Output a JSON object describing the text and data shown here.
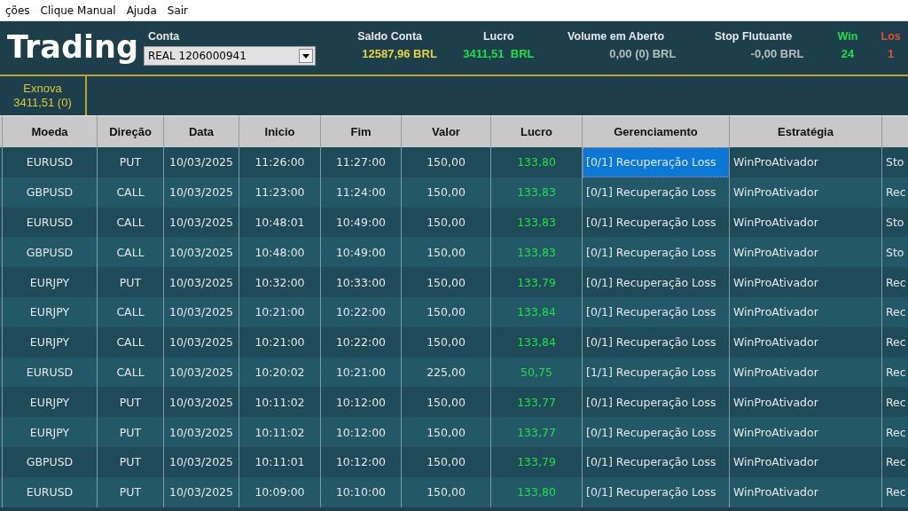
{
  "menu": [
    "ções",
    "Clique Manual",
    "Ajuda",
    "Sair"
  ],
  "header": {
    "title": "Trading",
    "account": {
      "label": "Conta",
      "value": "REAL 1206000941"
    },
    "stats": [
      {
        "label": "Saldo Conta",
        "value": "12587,96 BRL",
        "color": "#e8d53c",
        "kind": "amount"
      },
      {
        "label": "Lucro",
        "value": "3411,51  BRL",
        "color": "#1fe048",
        "kind": "amount"
      },
      {
        "label": "Volume em Aberto",
        "value": "0,00 (0) BRL",
        "color": "#b8bcbe",
        "kind": "amount"
      },
      {
        "label": "Stop Flutuante",
        "value": "-0,00 BRL",
        "color": "#b8bcbe",
        "kind": "amount"
      },
      {
        "label": "Win",
        "value": "24",
        "color": "#1fe048",
        "kind": "count"
      },
      {
        "label": "Los",
        "value": "1",
        "color": "#e0522e",
        "kind": "count"
      }
    ]
  },
  "tabs": [
    {
      "label": "Exnova",
      "value": "3411,51 (0)",
      "selected": true
    }
  ],
  "table": {
    "columns": [
      "Moeda",
      "Direção",
      "Data",
      "Inicio",
      "Fim",
      "Valor",
      "Lucro",
      "Gerenciamento",
      "Estratégia"
    ],
    "rows": [
      {
        "selected": true,
        "cells": [
          "EURUSD",
          "PUT",
          "10/03/2025",
          "11:26:00",
          "11:27:00",
          "150,00",
          "133,80",
          "[0/1] Recuperação Loss",
          "WinProAtivador",
          "Sto"
        ]
      },
      {
        "selected": false,
        "cells": [
          "GBPUSD",
          "CALL",
          "10/03/2025",
          "11:23:00",
          "11:24:00",
          "150,00",
          "133,83",
          "[0/1] Recuperação Loss",
          "WinProAtivador",
          "Rec"
        ]
      },
      {
        "selected": false,
        "cells": [
          "EURUSD",
          "CALL",
          "10/03/2025",
          "10:48:01",
          "10:49:00",
          "150,00",
          "133,83",
          "[0/1] Recuperação Loss",
          "WinProAtivador",
          "Sto"
        ]
      },
      {
        "selected": false,
        "cells": [
          "GBPUSD",
          "CALL",
          "10/03/2025",
          "10:48:00",
          "10:49:00",
          "150,00",
          "133,83",
          "[0/1] Recuperação Loss",
          "WinProAtivador",
          "Sto"
        ]
      },
      {
        "selected": false,
        "cells": [
          "EURJPY",
          "PUT",
          "10/03/2025",
          "10:32:00",
          "10:33:00",
          "150,00",
          "133,79",
          "[0/1] Recuperação Loss",
          "WinProAtivador",
          "Rec"
        ]
      },
      {
        "selected": false,
        "cells": [
          "EURJPY",
          "CALL",
          "10/03/2025",
          "10:21:00",
          "10:22:00",
          "150,00",
          "133,84",
          "[0/1] Recuperação Loss",
          "WinProAtivador",
          "Rec"
        ]
      },
      {
        "selected": false,
        "cells": [
          "EURJPY",
          "CALL",
          "10/03/2025",
          "10:21:00",
          "10:22:00",
          "150,00",
          "133,84",
          "[0/1] Recuperação Loss",
          "WinProAtivador",
          "Rec"
        ]
      },
      {
        "selected": false,
        "cells": [
          "EURUSD",
          "CALL",
          "10/03/2025",
          "10:20:02",
          "10:21:00",
          "225,00",
          "50,75",
          "[1/1] Recuperação Loss",
          "WinProAtivador",
          "Rec"
        ]
      },
      {
        "selected": false,
        "cells": [
          "EURJPY",
          "PUT",
          "10/03/2025",
          "10:11:02",
          "10:12:00",
          "150,00",
          "133,77",
          "[0/1] Recuperação Loss",
          "WinProAtivador",
          "Rec"
        ]
      },
      {
        "selected": false,
        "cells": [
          "EURJPY",
          "PUT",
          "10/03/2025",
          "10:11:02",
          "10:12:00",
          "150,00",
          "133,77",
          "[0/1] Recuperação Loss",
          "WinProAtivador",
          "Rec"
        ]
      },
      {
        "selected": false,
        "cells": [
          "GBPUSD",
          "PUT",
          "10/03/2025",
          "10:11:01",
          "10:12:00",
          "150,00",
          "133,79",
          "[0/1] Recuperação Loss",
          "WinProAtivador",
          "Rec"
        ]
      },
      {
        "selected": false,
        "cells": [
          "EURUSD",
          "PUT",
          "10/03/2025",
          "10:09:00",
          "10:10:00",
          "150,00",
          "133,80",
          "[0/1] Recuperação Loss",
          "WinProAtivador",
          "Rec"
        ]
      }
    ]
  }
}
